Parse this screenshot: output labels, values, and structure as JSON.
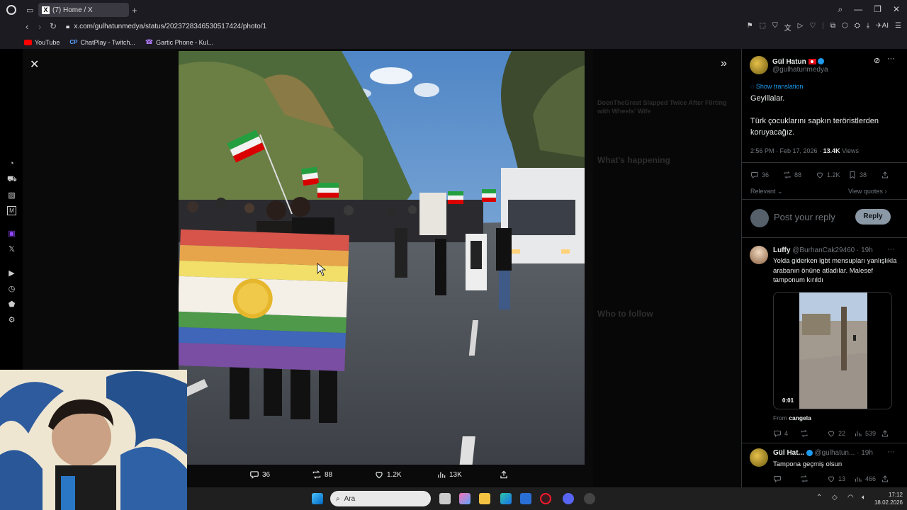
{
  "browser": {
    "tab_title": "(7) Home / X",
    "url": "x.com/gulhatunmedya/status/2023728346530517424/photo/1",
    "bookmarks": [
      "YouTube",
      "ChatPlay - Twitch...",
      "Gartic Phone - Kul..."
    ],
    "ai_label": "AI"
  },
  "photo_actions": {
    "replies": "36",
    "reposts": "88",
    "likes": "1.2K",
    "views": "13K"
  },
  "tweet": {
    "author_name": "Gül Hatun",
    "author_handle": "@gulhatunmedya",
    "show_translation": "Show translation",
    "line1": "Geyillalar.",
    "line2": "Türk çocuklarını sapkın teröristlerden koruyacağız.",
    "time": "2:56 PM · Feb 17, 2026 ·",
    "views_count": "13.4K",
    "views_label": "Views",
    "stats": {
      "replies": "36",
      "reposts": "88",
      "likes": "1.2K",
      "bookmarks": "38"
    },
    "sort_label": "Relevant",
    "view_quotes": "View quotes",
    "reply_placeholder": "Post your reply",
    "reply_button": "Reply"
  },
  "replies": [
    {
      "name": "Luffy",
      "handle": "@BurhanCak29460 · 19h",
      "text": "Yolda giderken lgbt mensupları yanlışlıkla arabanın önüne atladılar. Malesef tamponum kırıldı",
      "video_time": "0:01",
      "from_label": "From",
      "from_user": "cangela",
      "stats": {
        "replies": "4",
        "reposts": "",
        "likes": "22",
        "views": "539"
      }
    },
    {
      "name": "Gül Hat...",
      "handle": "@gulhatun... · 19h",
      "text": "Tampona geçmiş olsun",
      "stats": {
        "replies": "",
        "reposts": "",
        "likes": "13",
        "views": "466"
      }
    }
  ],
  "background_timeline": {
    "headline": "DoenTheGreat Slapped Twice After Flirting with Wheels' Wife",
    "whats_happening": "What's happening",
    "who_to_follow": "Who to follow"
  },
  "taskbar": {
    "search_placeholder": "Ara",
    "time": "17:12",
    "date": "18.02.2026"
  },
  "colors": {
    "x_blue": "#1d9bf0",
    "muted": "#71767b",
    "bg": "#000000"
  }
}
